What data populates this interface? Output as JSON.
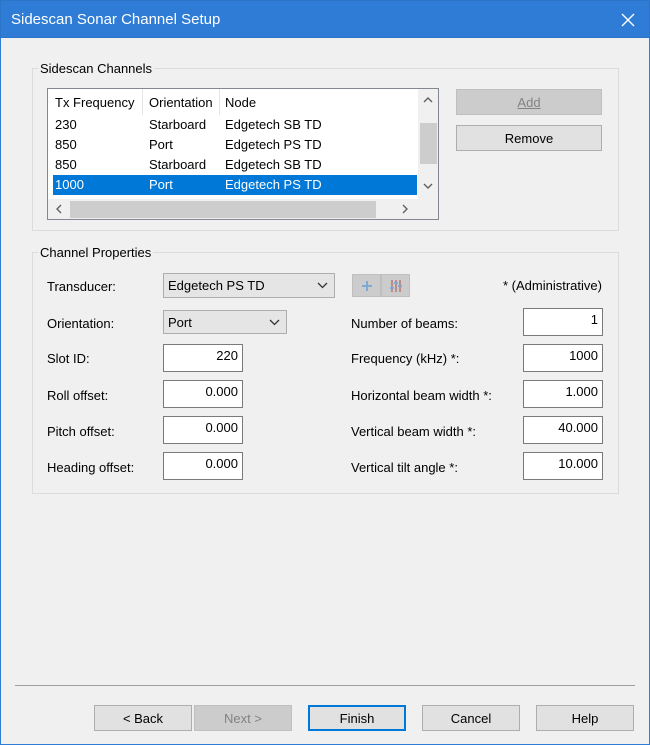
{
  "window": {
    "title": "Sidescan Sonar Channel Setup"
  },
  "channels_group": {
    "label": "Sidescan Channels",
    "columns": [
      "Tx Frequency",
      "Orientation",
      "Node"
    ],
    "rows": [
      [
        "230",
        "Starboard",
        "Edgetech SB TD"
      ],
      [
        "850",
        "Port",
        "Edgetech PS TD"
      ],
      [
        "850",
        "Starboard",
        "Edgetech SB TD"
      ],
      [
        "1000",
        "Port",
        "Edgetech PS TD"
      ]
    ],
    "selected_row": 3,
    "add_label": "Add",
    "remove_label": "Remove"
  },
  "properties_group": {
    "label": "Channel Properties",
    "transducer_label": "Transducer:",
    "transducer_value": "Edgetech PS TD",
    "admin_note": "* (Administrative)",
    "orientation_label": "Orientation:",
    "orientation_value": "Port",
    "slot_label": "Slot ID:",
    "slot_value": "220",
    "roll_label": "Roll offset:",
    "roll_value": "0.000",
    "pitch_label": "Pitch offset:",
    "pitch_value": "0.000",
    "heading_label": "Heading offset:",
    "heading_value": "0.000",
    "beams_label": "Number of beams:",
    "beams_value": "1",
    "freq_label": "Frequency (kHz) *:",
    "freq_value": "1000",
    "hbw_label": "Horizontal beam width *:",
    "hbw_value": "1.000",
    "vbw_label": "Vertical beam width *:",
    "vbw_value": "40.000",
    "tilt_label": "Vertical tilt angle *:",
    "tilt_value": "10.000"
  },
  "footer": {
    "back_label": "< Back",
    "next_label": "Next >",
    "finish_label": "Finish",
    "cancel_label": "Cancel",
    "help_label": "Help"
  },
  "colors": {
    "titlebar": "#2e7cd6",
    "selection": "#0078d7",
    "default_button_border": "#0078d7"
  },
  "icons": [
    "close-icon",
    "chevron-down-icon",
    "chevron-up-icon",
    "chevron-left-icon",
    "chevron-right-icon",
    "add-plus-icon",
    "sliders-icon"
  ]
}
